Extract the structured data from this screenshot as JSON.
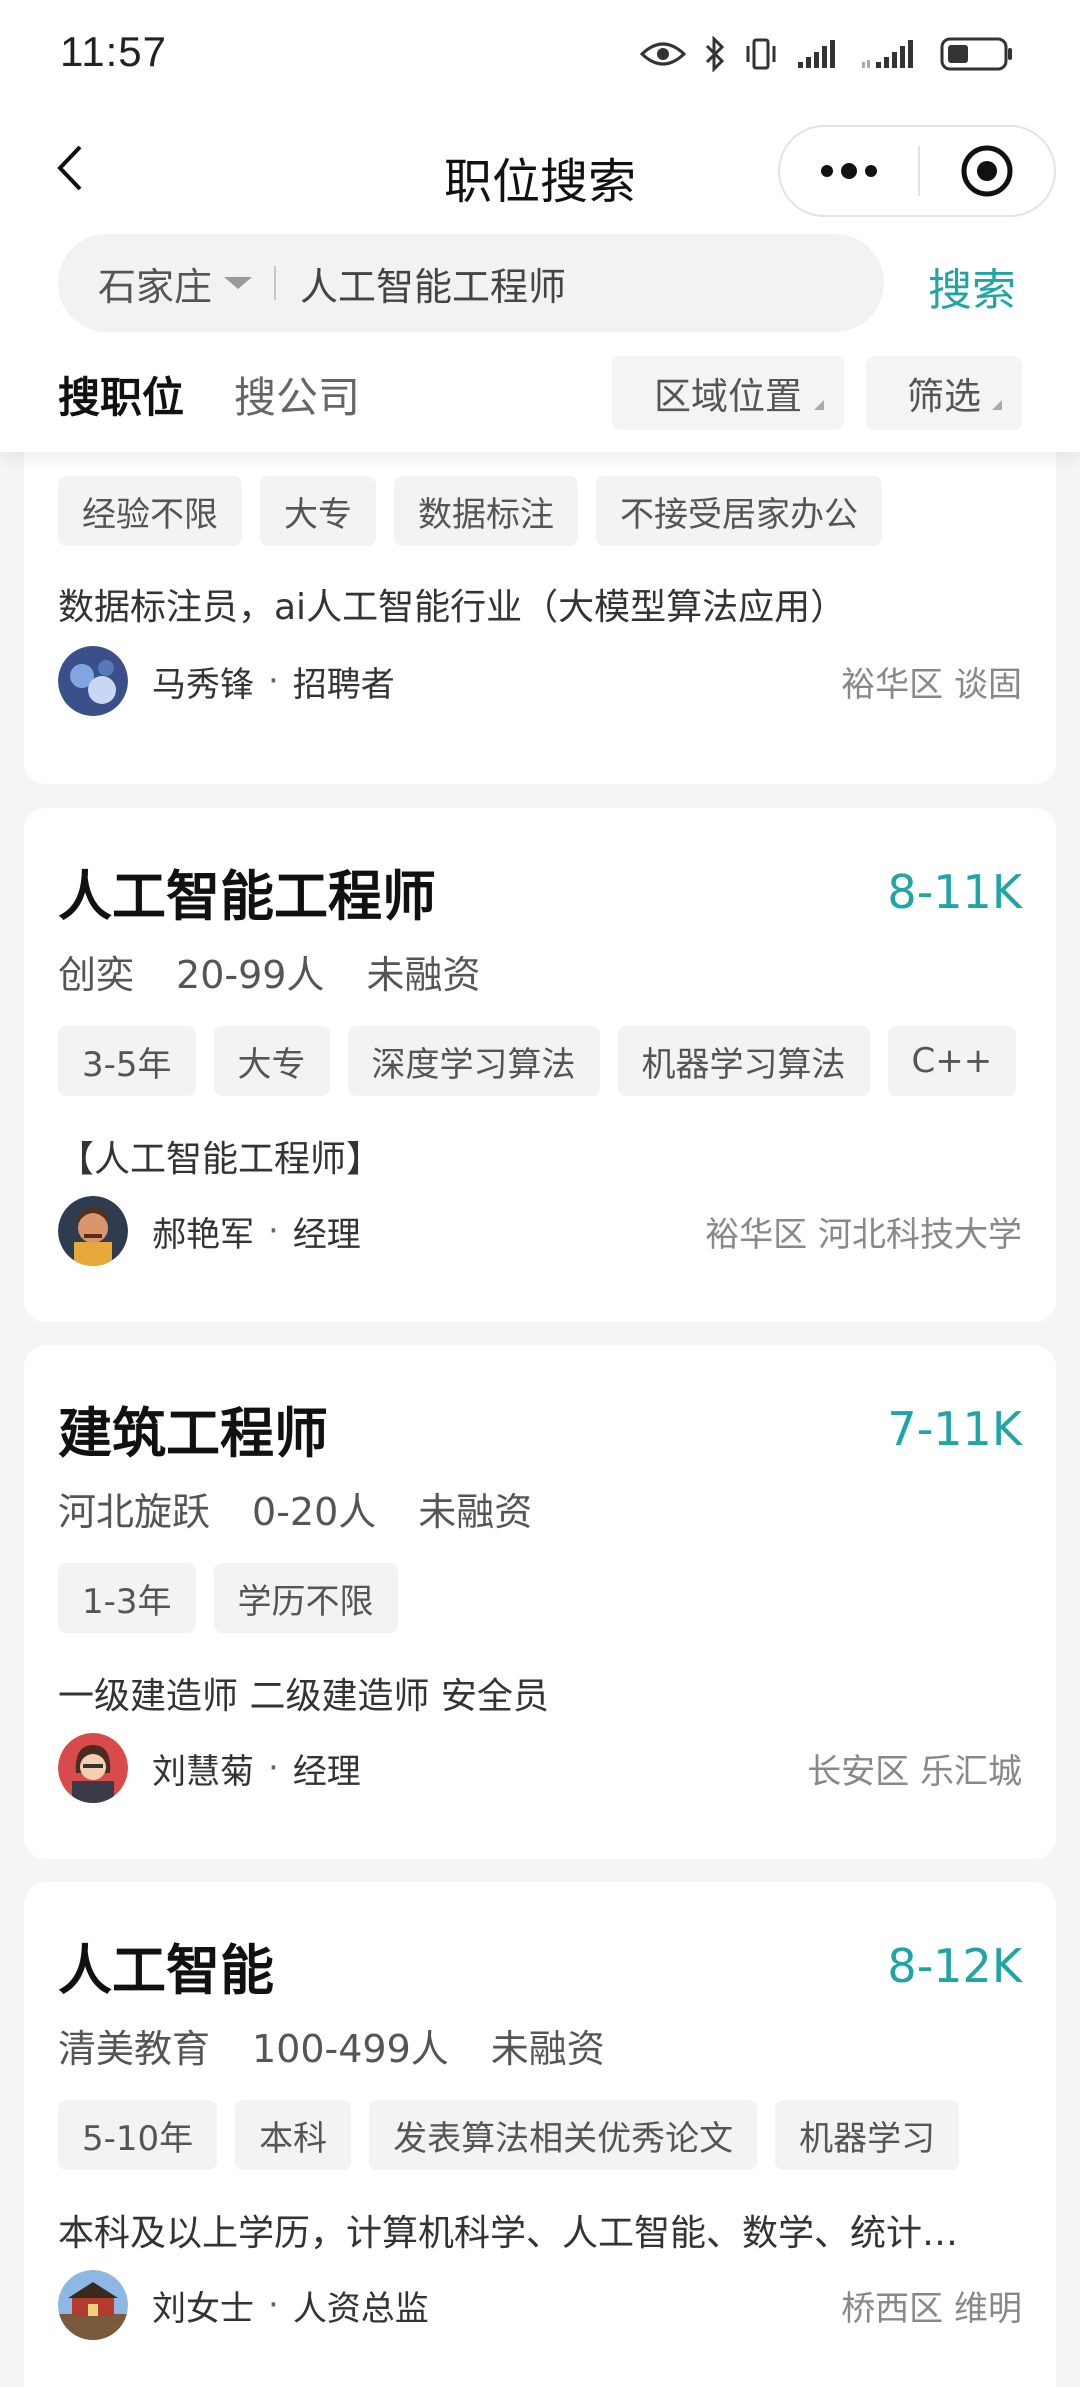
{
  "status_bar": {
    "time": "11:57",
    "icons": [
      "eye-icon",
      "bluetooth-icon",
      "vibrate-icon",
      "signal-icon",
      "signal-icon",
      "battery-icon"
    ]
  },
  "nav": {
    "title": "职位搜索",
    "back_icon": "chevron-left-icon",
    "more_icon": "more-dots-icon",
    "close_icon": "target-circle-icon"
  },
  "search": {
    "city": "石家庄",
    "query": "人工智能工程师",
    "button_label": "搜索"
  },
  "filters": {
    "tabs": [
      {
        "label": "搜职位",
        "active": true
      },
      {
        "label": "搜公司",
        "active": false
      }
    ],
    "chips": [
      "区域位置",
      "筛选"
    ]
  },
  "accent_color": "#1fa5a5",
  "jobs": [
    {
      "tags": [
        "经验不限",
        "大专",
        "数据标注",
        "不接受居家办公"
      ],
      "description": "数据标注员，ai人工智能行业（大模型算法应用）",
      "recruiter_name": "马秀锋",
      "recruiter_role": "招聘者",
      "location": "裕华区 谈固"
    },
    {
      "title": "人工智能工程师",
      "salary": "8-11K",
      "company": "创奕",
      "size": "20-99人",
      "funding": "未融资",
      "tags": [
        "3-5年",
        "大专",
        "深度学习算法",
        "机器学习算法",
        "C++"
      ],
      "description": "【人工智能工程师】",
      "recruiter_name": "郝艳军",
      "recruiter_role": "经理",
      "location": "裕华区 河北科技大学"
    },
    {
      "title": "建筑工程师",
      "salary": "7-11K",
      "company": "河北旋跃",
      "size": "0-20人",
      "funding": "未融资",
      "tags": [
        "1-3年",
        "学历不限"
      ],
      "description": "一级建造师 二级建造师 安全员",
      "recruiter_name": "刘慧菊",
      "recruiter_role": "经理",
      "location": "长安区 乐汇城"
    },
    {
      "title": "人工智能",
      "salary": "8-12K",
      "company": "清美教育",
      "size": "100-499人",
      "funding": "未融资",
      "tags": [
        "5-10年",
        "本科",
        "发表算法相关优秀论文",
        "机器学习"
      ],
      "description": "本科及以上学历，计算机科学、人工智能、数学、统计…",
      "recruiter_name": "刘女士",
      "recruiter_role": "人资总监",
      "location": "桥西区 维明"
    }
  ]
}
